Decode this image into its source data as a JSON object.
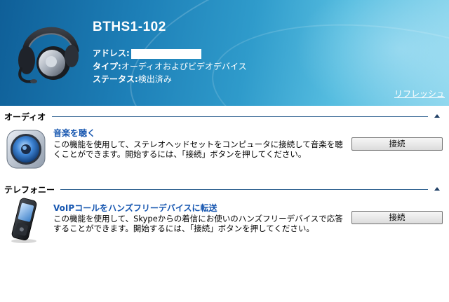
{
  "device": {
    "name": "BTHS1-102",
    "address_label": "アドレス:",
    "type_label": "タイプ:",
    "type_value": "オーディオおよびビデオデバイス",
    "status_label": "ステータス:",
    "status_value": "検出済み",
    "refresh_label": "リフレッシュ"
  },
  "sections": [
    {
      "title": "オーディオ",
      "item_title": "音楽を聴く",
      "item_desc": "この機能を使用して、ステレオヘッドセットをコンピュータに接続して音楽を聴くことができます。開始するには、「接続」ボタンを押してください。",
      "button_label": "接続",
      "icon": "speaker-icon"
    },
    {
      "title": "テレフォニー",
      "item_title": "VoIPコールをハンズフリーデバイスに転送",
      "item_desc": "この機能を使用して、Skypeからの着信にお使いのハンズフリーデバイスで応答することができます。開始するには、「接続」ボタンを押してください。",
      "button_label": "接続",
      "icon": "mobile-phone-icon"
    }
  ],
  "colors": {
    "header_dark": "#0f5f98",
    "header_light": "#8fd7ee",
    "link_blue": "#1656b0",
    "divider": "#2c5f8f"
  }
}
